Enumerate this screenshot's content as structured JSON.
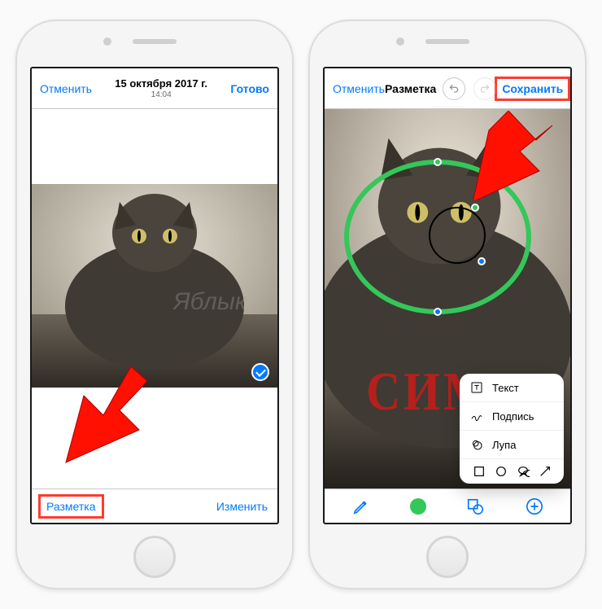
{
  "left": {
    "nav": {
      "cancel": "Отменить",
      "date": "15 октября 2017 г.",
      "time": "14:04",
      "done": "Готово"
    },
    "footer": {
      "markup": "Разметка",
      "edit": "Изменить"
    }
  },
  "right": {
    "nav": {
      "cancel": "Отменить",
      "title": "Разметка",
      "save": "Сохранить"
    },
    "annotation_text": "СИМА",
    "popover": {
      "items": [
        {
          "id": "text",
          "label": "Текст"
        },
        {
          "id": "signature",
          "label": "Подпись"
        },
        {
          "id": "magnifier",
          "label": "Лупа"
        }
      ],
      "shapes": [
        "square",
        "circle",
        "speech",
        "arrow"
      ]
    },
    "toolbar": [
      "pen",
      "color",
      "shapes",
      "add"
    ]
  },
  "watermark": "Яблык",
  "colors": {
    "ios_blue": "#007aff",
    "highlight": "#ff3b2f",
    "green": "#34c759"
  }
}
